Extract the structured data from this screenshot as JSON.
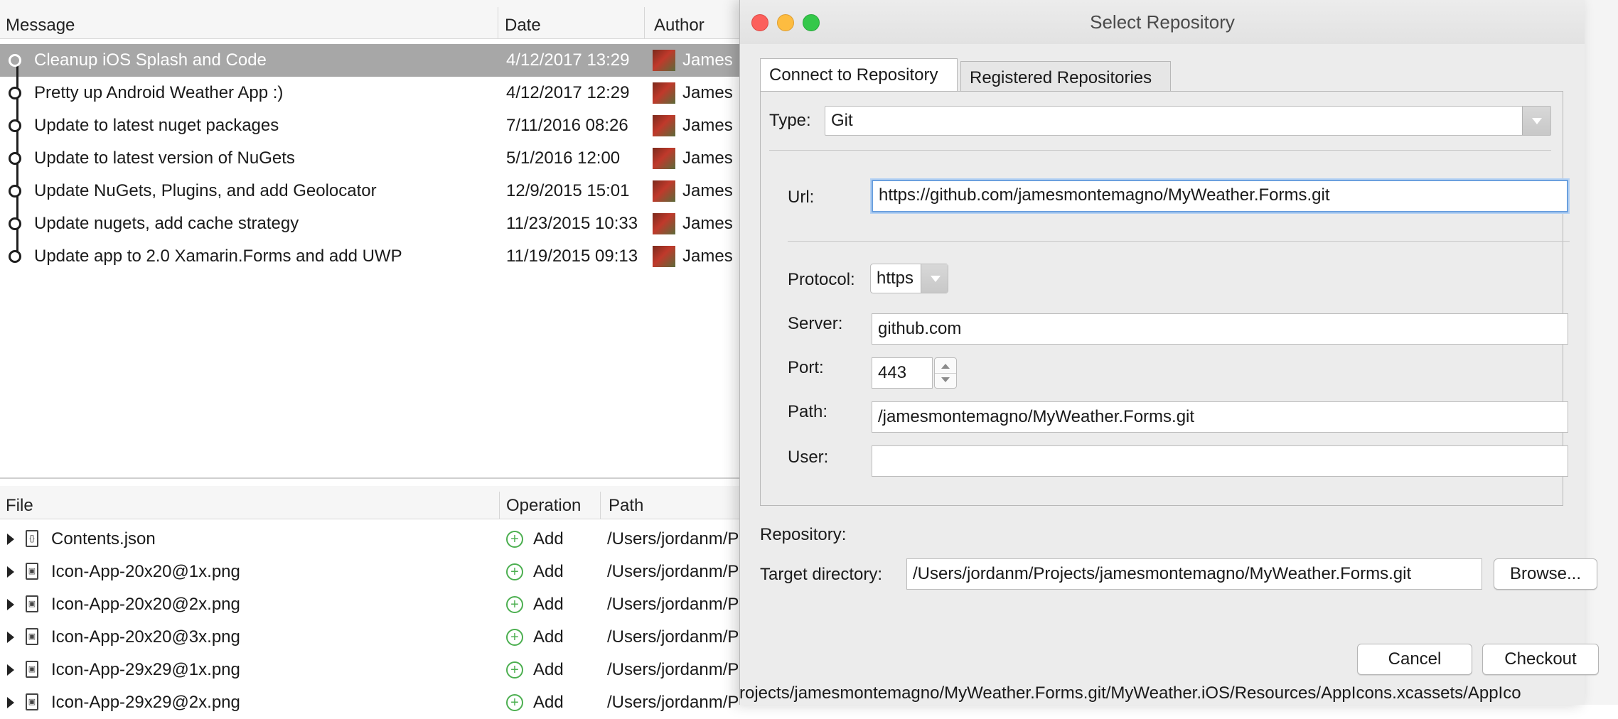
{
  "log": {
    "columns": {
      "message": "Message",
      "date": "Date",
      "author": "Author"
    },
    "commits": [
      {
        "message": "Cleanup iOS Splash and Code",
        "date": "4/12/2017 13:29",
        "author": "James"
      },
      {
        "message": "Pretty up Android Weather App :)",
        "date": "4/12/2017 12:29",
        "author": "James"
      },
      {
        "message": "Update to latest nuget packages",
        "date": "7/11/2016 08:26",
        "author": "James"
      },
      {
        "message": "Update to latest version of NuGets",
        "date": "5/1/2016 12:00",
        "author": "James"
      },
      {
        "message": "Update NuGets, Plugins, and add Geolocator",
        "date": "12/9/2015 15:01",
        "author": "James"
      },
      {
        "message": "Update nugets, add cache strategy",
        "date": "11/23/2015 10:33",
        "author": "James"
      },
      {
        "message": "Update app to 2.0 Xamarin.Forms and add UWP",
        "date": "11/19/2015 09:13",
        "author": "James"
      }
    ],
    "selected_index": 0
  },
  "files": {
    "columns": {
      "file": "File",
      "operation": "Operation",
      "path": "Path"
    },
    "rows": [
      {
        "name": "Contents.json",
        "icon": "json-file-icon",
        "glyph": "{}",
        "operation": "Add",
        "path": "/Users/jordanm/P"
      },
      {
        "name": "Icon-App-20x20@1x.png",
        "icon": "image-file-icon",
        "glyph": "▣",
        "operation": "Add",
        "path": "/Users/jordanm/P"
      },
      {
        "name": "Icon-App-20x20@2x.png",
        "icon": "image-file-icon",
        "glyph": "▣",
        "operation": "Add",
        "path": "/Users/jordanm/P"
      },
      {
        "name": "Icon-App-20x20@3x.png",
        "icon": "image-file-icon",
        "glyph": "▣",
        "operation": "Add",
        "path": "/Users/jordanm/P"
      },
      {
        "name": "Icon-App-29x29@1x.png",
        "icon": "image-file-icon",
        "glyph": "▣",
        "operation": "Add",
        "path": "/Users/jordanm/P"
      },
      {
        "name": "Icon-App-29x29@2x.png",
        "icon": "image-file-icon",
        "glyph": "▣",
        "operation": "Add",
        "path": "/Users/jordanm/P"
      }
    ],
    "partial_path_tail": "rojects/jamesmontemagno/MyWeather.Forms.git/MyWeather.iOS/Resources/AppIcons.xcassets/AppIco"
  },
  "dialog": {
    "title": "Select Repository",
    "tabs": [
      {
        "label": "Connect to Repository",
        "active": true
      },
      {
        "label": "Registered Repositories",
        "active": false
      }
    ],
    "type_label": "Type:",
    "type_value": "Git",
    "url_label": "Url:",
    "url_value": "https://github.com/jamesmontemagno/MyWeather.Forms.git",
    "protocol_label": "Protocol:",
    "protocol_value": "https",
    "server_label": "Server:",
    "server_value": "github.com",
    "port_label": "Port:",
    "port_value": "443",
    "path_label": "Path:",
    "path_value": "/jamesmontemagno/MyWeather.Forms.git",
    "user_label": "User:",
    "user_value": "",
    "repository_label": "Repository:",
    "target_label": "Target directory:",
    "target_value": "/Users/jordanm/Projects/jamesmontemagno/MyWeather.Forms.git",
    "browse_label": "Browse...",
    "cancel_label": "Cancel",
    "checkout_label": "Checkout"
  },
  "colors": {
    "selection": "#a7a7a7",
    "add_icon": "#4caf50",
    "focus_ring": "#6ba0de",
    "close": "#fc605c",
    "minimize": "#fdbc40",
    "zoom": "#34c84a"
  }
}
